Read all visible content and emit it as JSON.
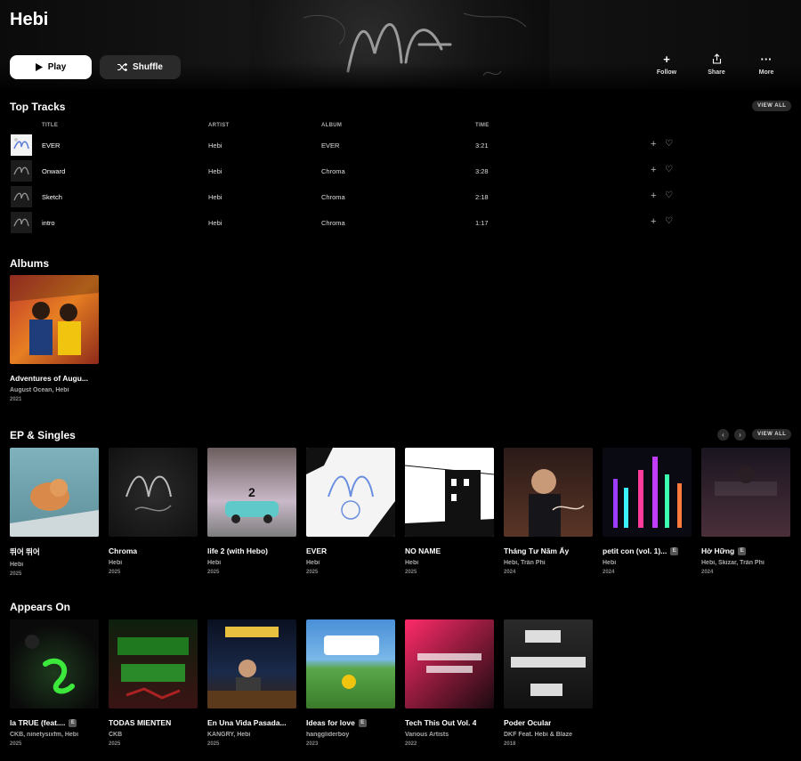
{
  "artist": {
    "name": "Hebi"
  },
  "hero": {
    "play_label": "Play",
    "shuffle_label": "Shuffle",
    "follow_label": "Follow",
    "share_label": "Share",
    "more_label": "More"
  },
  "top_tracks": {
    "title": "Top Tracks",
    "view_all": "VIEW ALL",
    "headers": {
      "title": "TITLE",
      "artist": "ARTIST",
      "album": "ALBUM",
      "time": "TIME"
    },
    "rows": [
      {
        "title": "EVER",
        "artist": "Hebi",
        "album": "EVER",
        "time": "3:21"
      },
      {
        "title": "Onward",
        "artist": "Hebi",
        "album": "Chroma",
        "time": "3:28"
      },
      {
        "title": "Sketch",
        "artist": "Hebi",
        "album": "Chroma",
        "time": "2:18"
      },
      {
        "title": "intro",
        "artist": "Hebi",
        "album": "Chroma",
        "time": "1:17"
      }
    ]
  },
  "albums": {
    "title": "Albums",
    "items": [
      {
        "title": "Adventures of Augu...",
        "artists": "August Ocean, Hebi",
        "year": "2021"
      }
    ]
  },
  "eps": {
    "title": "EP & Singles",
    "view_all": "VIEW ALL",
    "items": [
      {
        "title": "뛰어 뛰어",
        "artists": "Hebi",
        "year": "2025",
        "explicit": false
      },
      {
        "title": "Chroma",
        "artists": "Hebi",
        "year": "2025",
        "explicit": false
      },
      {
        "title": "life 2 (with Hebo)",
        "artists": "Hebi",
        "year": "2025",
        "explicit": false
      },
      {
        "title": "EVER",
        "artists": "Hebi",
        "year": "2025",
        "explicit": false
      },
      {
        "title": "NO NAME",
        "artists": "Hebi",
        "year": "2025",
        "explicit": false
      },
      {
        "title": "Tháng Tư Năm Ấy",
        "artists": "Hebi, Trần Phi",
        "year": "2024",
        "explicit": false
      },
      {
        "title": "petit con (vol. 1)...",
        "artists": "Hebi",
        "year": "2024",
        "explicit": true
      },
      {
        "title": "Hờ Hững",
        "artists": "Hebi, Skizar, Trần Phi",
        "year": "2024",
        "explicit": true
      }
    ]
  },
  "appears_on": {
    "title": "Appears On",
    "items": [
      {
        "title": "la TRUE (feat....",
        "artists": "CKB, ninetysixfm, Hebi",
        "year": "2025",
        "explicit": true
      },
      {
        "title": "TODAS MIENTEN",
        "artists": "CKB",
        "year": "2025",
        "explicit": false
      },
      {
        "title": "En Una Vida Pasada...",
        "artists": "KANGRY, Hebi",
        "year": "2025",
        "explicit": false
      },
      {
        "title": "Ideas for love",
        "artists": "hanggliderboy",
        "year": "2023",
        "explicit": true
      },
      {
        "title": "Tech This Out Vol. 4",
        "artists": "Various Artists",
        "year": "2022",
        "explicit": false
      },
      {
        "title": "Poder Ocular",
        "artists": "DKF Feat. Hebi & Blaze",
        "year": "2018",
        "explicit": false
      }
    ]
  },
  "explicit_badge": "E",
  "icons": {
    "play": "play-icon",
    "shuffle": "shuffle-icon",
    "follow": "plus-icon",
    "share": "share-icon",
    "more": "more-icon",
    "add": "plus-icon",
    "favorite": "heart-icon",
    "prev": "chevron-left-icon",
    "next": "chevron-right-icon"
  },
  "colors": {
    "background": "#000000",
    "play_button": "#ffffff",
    "secondary_button": "#2a2a2a",
    "muted_text": "#aaaaaa"
  }
}
